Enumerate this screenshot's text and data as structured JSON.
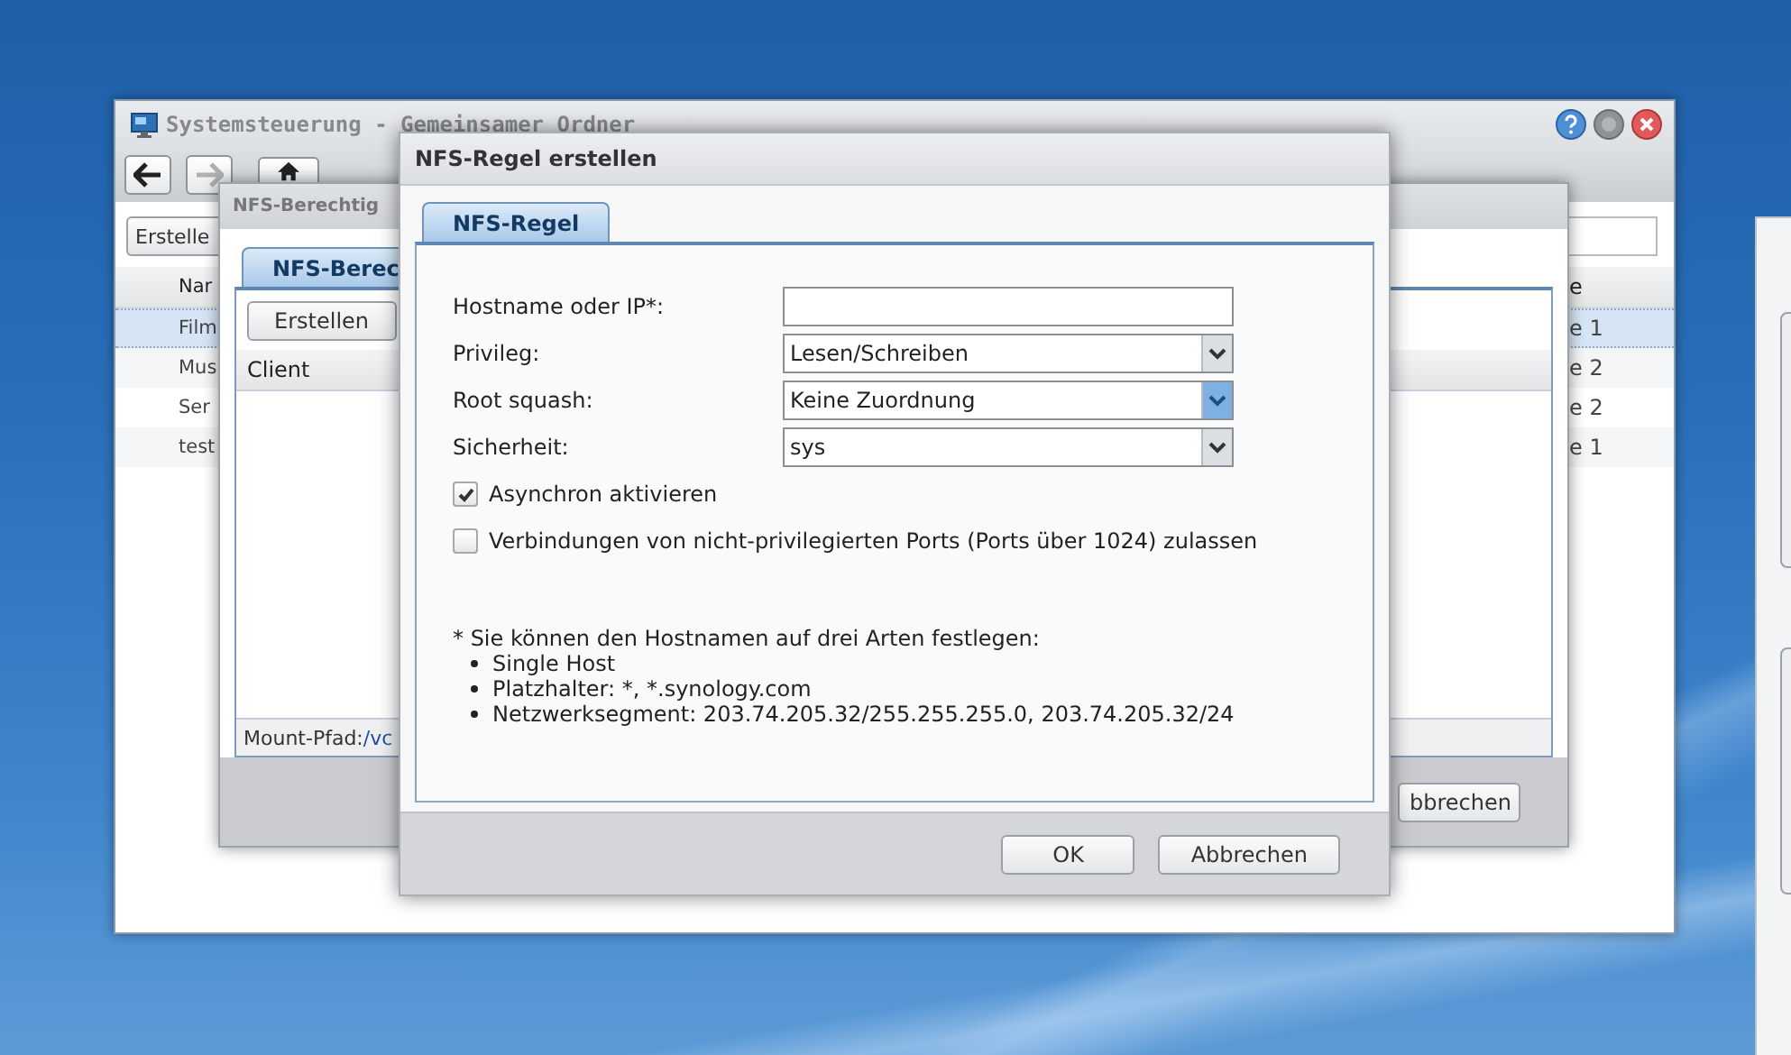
{
  "control_panel": {
    "title": "Systemsteuerung - Gemeinsamer Ordner",
    "nav_buttons": [
      {
        "kind": "back",
        "disabled": false
      },
      {
        "kind": "forward",
        "disabled": true
      },
      {
        "kind": "home",
        "disabled": false
      }
    ],
    "create_button": "Erstelle",
    "table": {
      "column_1": "Nar",
      "column_2": "e",
      "rows": [
        {
          "cells": [
            "Film",
            "e 1"
          ],
          "selected": true
        },
        {
          "cells": [
            "Mus",
            "e 2"
          ],
          "selected": false
        },
        {
          "cells": [
            "Ser",
            "e 2"
          ],
          "selected": false
        },
        {
          "cells": [
            "test",
            "e 1"
          ],
          "selected": false
        }
      ]
    }
  },
  "permissions_window": {
    "title": "NFS-Berechtig",
    "tab": {
      "label": "NFS-Berec",
      "selected": true
    },
    "create_button": "Erstellen",
    "column": "Client",
    "mount_path_label": "Mount-Pfad:",
    "mount_path_value": "/vc",
    "cancel_button": "bbrechen"
  },
  "dialog": {
    "title": "NFS-Regel erstellen",
    "tab": {
      "label": "NFS-Regel",
      "selected": true
    },
    "fields": [
      {
        "kind": "text",
        "label": "Hostname oder IP*:"
      },
      {
        "kind": "select",
        "label": "Privileg:",
        "value": "Lesen/Schreiben",
        "highlighted": false
      },
      {
        "kind": "select",
        "label": "Root squash:",
        "value": "Keine Zuordnung",
        "highlighted": true
      },
      {
        "kind": "select",
        "label": "Sicherheit:",
        "value": "sys",
        "highlighted": false
      }
    ],
    "checkboxes": [
      {
        "label": "Asynchron aktivieren",
        "checked": true
      },
      {
        "label": "Verbindungen von nicht-privilegierten Ports (Ports über 1024) zulassen",
        "checked": false
      }
    ],
    "note": {
      "intro": "* Sie können den Hostnamen auf drei Arten festlegen:",
      "items": [
        "Single Host",
        "Platzhalter: *, *.synology.com",
        "Netzwerksegment: 203.74.205.32/255.255.255.0, 203.74.205.32/24"
      ]
    },
    "buttons": [
      "OK",
      "Abbrechen"
    ]
  }
}
